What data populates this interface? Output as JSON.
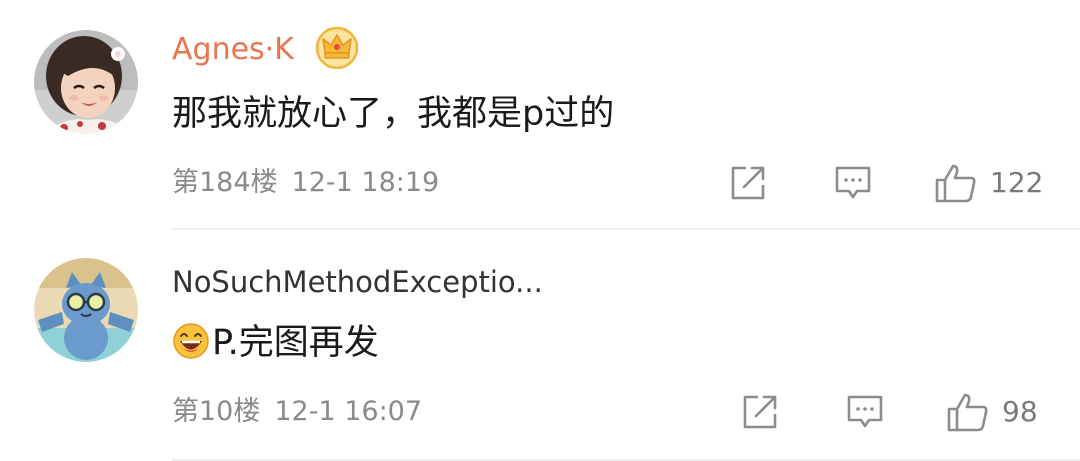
{
  "comments": [
    {
      "username": "Agnes·K",
      "badge_icon": "vip-crown-icon",
      "content": "那我就放心了，我都是p过的",
      "floor": "第184楼",
      "timestamp": "12-1 18:19",
      "likes": "122",
      "avatar_icon": "girl-avatar"
    },
    {
      "username": "NoSuchMethodExceptio...",
      "emoji": "laughing-face-emoji",
      "content": "P.完图再发",
      "floor": "第10楼",
      "timestamp": "12-1 16:07",
      "likes": "98",
      "avatar_icon": "blue-cat-sunglasses-avatar"
    }
  ],
  "colors": {
    "vip_username": "#eb7350",
    "normal_username": "#333333",
    "meta_text": "#8a8a8a",
    "icon_stroke": "#8c8c8c",
    "divider": "#eeeeee"
  }
}
